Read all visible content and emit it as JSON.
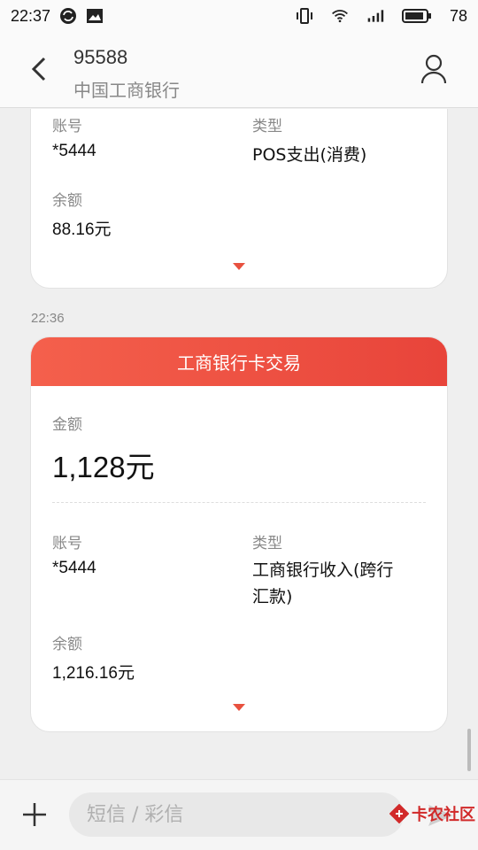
{
  "status_bar": {
    "time": "22:37",
    "battery": "78"
  },
  "header": {
    "number": "95588",
    "name": "中国工商银行"
  },
  "card_partial": {
    "account_label": "账号",
    "account_value": "*5444",
    "type_label": "类型",
    "type_value": "POS支出(消费)",
    "balance_label": "余额",
    "balance_value": "88.16元"
  },
  "timestamp": "22:36",
  "card_main": {
    "title": "工商银行卡交易",
    "amount_label": "金额",
    "amount_value": "1,128元",
    "account_label": "账号",
    "account_value": "*5444",
    "type_label": "类型",
    "type_value_line1": "工商银行收入(跨行",
    "type_value_line2": "汇款)",
    "balance_label": "余额",
    "balance_value": "1,216.16元"
  },
  "composer": {
    "placeholder": "短信 / 彩信"
  },
  "watermark": {
    "text": "卡农社区"
  },
  "colors": {
    "accent": "#e8443a",
    "card_header_start": "#f4604c"
  }
}
